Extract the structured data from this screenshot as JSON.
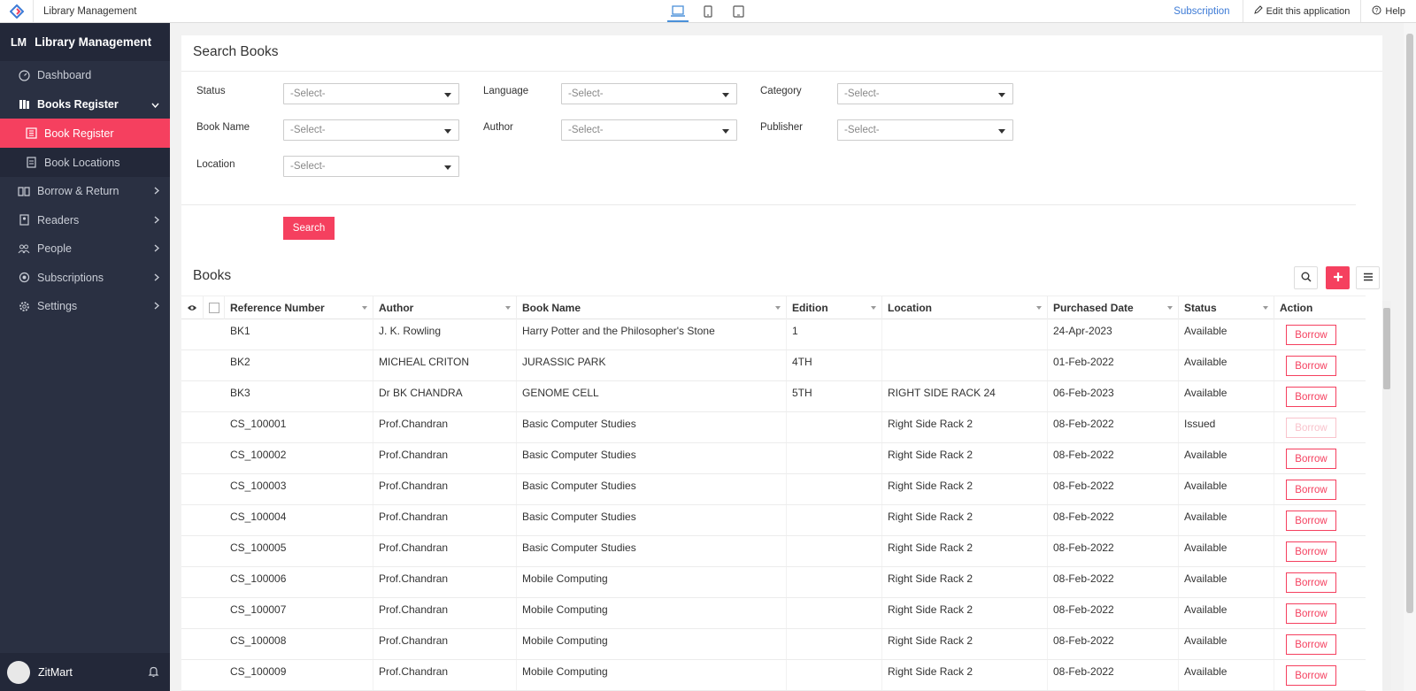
{
  "topbar": {
    "app_title": "Library Management",
    "subscription_link": "Subscription",
    "edit_label": "Edit this application",
    "help_label": "Help",
    "devices": [
      "laptop-icon",
      "mobile-icon",
      "tablet-icon"
    ]
  },
  "sidebar": {
    "brand_abbr": "LM",
    "brand_name": "Library Management",
    "items": [
      {
        "label": "Dashboard",
        "icon": "dashboard-icon"
      },
      {
        "label": "Books Register",
        "icon": "books-icon",
        "expanded": true
      },
      {
        "label": "Book Register",
        "icon": "book-register-icon",
        "active": true
      },
      {
        "label": "Book Locations",
        "icon": "book-location-icon"
      },
      {
        "label": "Borrow & Return",
        "icon": "borrow-icon"
      },
      {
        "label": "Readers",
        "icon": "readers-icon"
      },
      {
        "label": "People",
        "icon": "people-icon"
      },
      {
        "label": "Subscriptions",
        "icon": "subscriptions-icon"
      },
      {
        "label": "Settings",
        "icon": "settings-icon"
      }
    ],
    "user_name": "ZitMart"
  },
  "search_panel": {
    "title": "Search Books",
    "filters": {
      "status_label": "Status",
      "language_label": "Language",
      "category_label": "Category",
      "book_name_label": "Book Name",
      "author_label": "Author",
      "publisher_label": "Publisher",
      "location_label": "Location",
      "select_placeholder": "-Select-"
    },
    "search_button": "Search"
  },
  "books": {
    "title": "Books",
    "columns": [
      "Reference Number",
      "Author",
      "Book Name",
      "Edition",
      "Location",
      "Purchased Date",
      "Status",
      "Action"
    ],
    "action_label": "Borrow",
    "rows": [
      {
        "ref": "BK1",
        "author": "J. K. Rowling",
        "book": "Harry Potter and the Philosopher's Stone",
        "edition": "1",
        "location": "",
        "date": "24-Apr-2023",
        "status": "Available",
        "disabled": false
      },
      {
        "ref": "BK2",
        "author": "MICHEAL CRITON",
        "book": "JURASSIC PARK",
        "edition": "4TH",
        "location": "",
        "date": "01-Feb-2022",
        "status": "Available",
        "disabled": false
      },
      {
        "ref": "BK3",
        "author": "Dr BK CHANDRA",
        "book": "GENOME CELL",
        "edition": "5TH",
        "location": "RIGHT SIDE RACK 24",
        "date": "06-Feb-2023",
        "status": "Available",
        "disabled": false
      },
      {
        "ref": "CS_100001",
        "author": "Prof.Chandran",
        "book": "Basic Computer Studies",
        "edition": "",
        "location": "Right Side Rack 2",
        "date": "08-Feb-2022",
        "status": "Issued",
        "disabled": true
      },
      {
        "ref": "CS_100002",
        "author": "Prof.Chandran",
        "book": "Basic Computer Studies",
        "edition": "",
        "location": "Right Side Rack 2",
        "date": "08-Feb-2022",
        "status": "Available",
        "disabled": false
      },
      {
        "ref": "CS_100003",
        "author": "Prof.Chandran",
        "book": "Basic Computer Studies",
        "edition": "",
        "location": "Right Side Rack 2",
        "date": "08-Feb-2022",
        "status": "Available",
        "disabled": false
      },
      {
        "ref": "CS_100004",
        "author": "Prof.Chandran",
        "book": "Basic Computer Studies",
        "edition": "",
        "location": "Right Side Rack 2",
        "date": "08-Feb-2022",
        "status": "Available",
        "disabled": false
      },
      {
        "ref": "CS_100005",
        "author": "Prof.Chandran",
        "book": "Basic Computer Studies",
        "edition": "",
        "location": "Right Side Rack 2",
        "date": "08-Feb-2022",
        "status": "Available",
        "disabled": false
      },
      {
        "ref": "CS_100006",
        "author": "Prof.Chandran",
        "book": "Mobile Computing",
        "edition": "",
        "location": "Right Side Rack 2",
        "date": "08-Feb-2022",
        "status": "Available",
        "disabled": false
      },
      {
        "ref": "CS_100007",
        "author": "Prof.Chandran",
        "book": "Mobile Computing",
        "edition": "",
        "location": "Right Side Rack 2",
        "date": "08-Feb-2022",
        "status": "Available",
        "disabled": false
      },
      {
        "ref": "CS_100008",
        "author": "Prof.Chandran",
        "book": "Mobile Computing",
        "edition": "",
        "location": "Right Side Rack 2",
        "date": "08-Feb-2022",
        "status": "Available",
        "disabled": false
      },
      {
        "ref": "CS_100009",
        "author": "Prof.Chandran",
        "book": "Mobile Computing",
        "edition": "",
        "location": "Right Side Rack 2",
        "date": "08-Feb-2022",
        "status": "Available",
        "disabled": false
      }
    ]
  },
  "colors": {
    "accent": "#f5405f",
    "sidebar_bg": "#2a3042",
    "link": "#3d7bd6"
  }
}
